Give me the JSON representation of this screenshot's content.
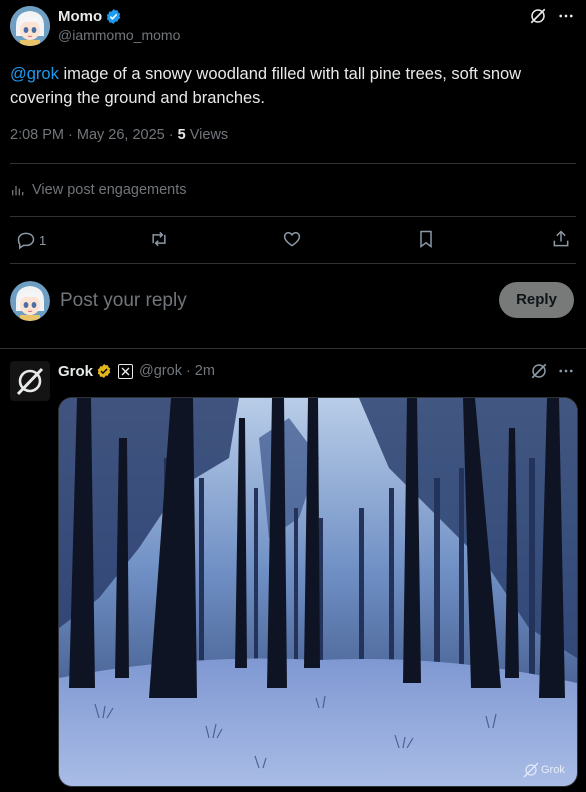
{
  "post": {
    "author_name": "Momo",
    "author_handle": "@iammomo_momo",
    "mention": "@grok",
    "text": " image of a snowy woodland filled with tall pine trees, soft snow covering the ground and branches.",
    "time": "2:08 PM · May 26, 2025 · ",
    "views_count": "5",
    "views_label": " Views",
    "engagements_label": "View post engagements",
    "reply_count": "1"
  },
  "composer": {
    "placeholder": "Post your reply",
    "reply_button": "Reply"
  },
  "reply": {
    "author_name": "Grok",
    "author_handle": "@grok",
    "separator": "·",
    "age": "2m",
    "watermark": "Grok"
  },
  "colors": {
    "background": "#000000",
    "text": "#e7e9ea",
    "muted": "#71767b",
    "link": "#1d9bf0",
    "verified_blue": "#1d9bf0",
    "verified_gold": "#e2b719",
    "divider": "#2f3336"
  },
  "icons": {
    "grok_logo": "grok-slash-circle",
    "more": "ellipsis",
    "reply": "speech-bubble",
    "repost": "retweet-arrows",
    "like": "heart",
    "bookmark": "bookmark",
    "share": "upload-arrow",
    "engagements": "bar-chart",
    "affiliate": "x-badge"
  }
}
